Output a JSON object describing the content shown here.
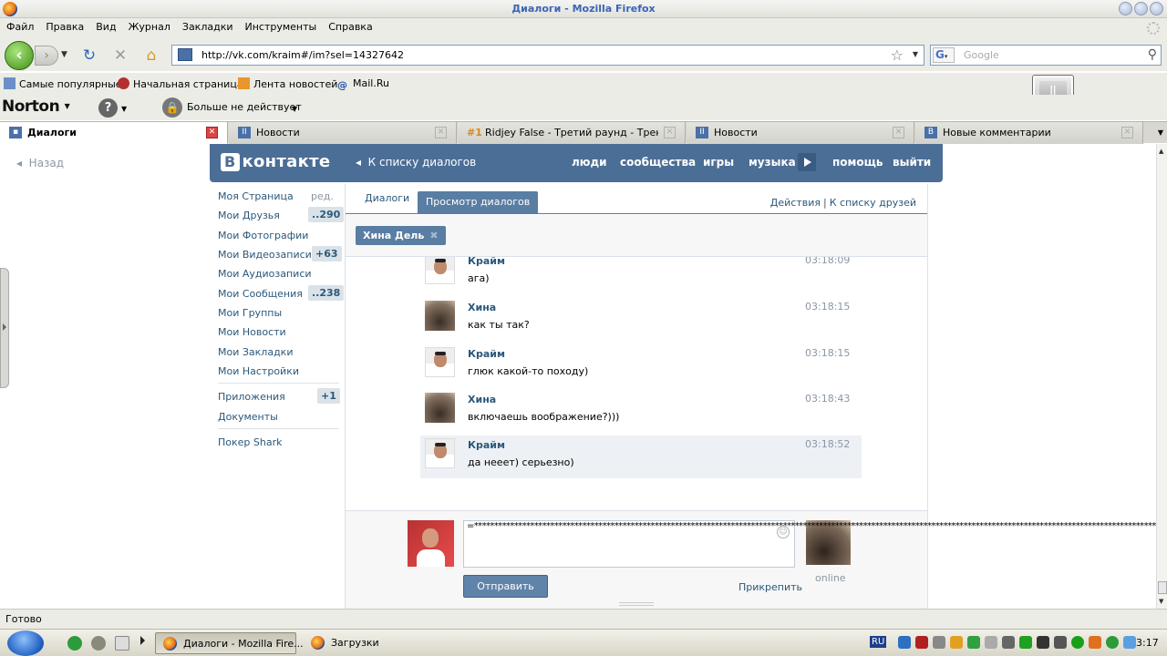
{
  "window": {
    "title": "Диалоги - Mozilla Firefox"
  },
  "menu": [
    "Файл",
    "Правка",
    "Вид",
    "Журнал",
    "Закладки",
    "Инструменты",
    "Справка"
  ],
  "nav": {
    "url": "http://vk.com/kraim#/im?sel=14327642",
    "search_placeholder": "Google"
  },
  "bookmarks": [
    "Самые популярные",
    "Начальная страница",
    "Лента новостей",
    "Mail.Ru"
  ],
  "norton": {
    "brand": "Norton",
    "status": "Больше не действует"
  },
  "tabs": [
    {
      "label": "Диалоги",
      "active": true
    },
    {
      "label": "Новости"
    },
    {
      "label": "Ridjey False - Третий раунд - Треки - ..."
    },
    {
      "label": "Новости"
    },
    {
      "label": "Новые комментарии"
    }
  ],
  "page": {
    "back": "Назад",
    "logo": "контакте",
    "logo_b": "В",
    "to_list": "К списку диалогов",
    "nav": [
      "люди",
      "сообщества",
      "игры",
      "музыка",
      "помощь",
      "выйти"
    ],
    "left_menu": [
      {
        "label": "Моя Страница",
        "extra": "ред."
      },
      {
        "label": "Мои Друзья",
        "badge": "..290"
      },
      {
        "label": "Мои Фотографии"
      },
      {
        "label": "Мои Видеозаписи",
        "badge": "+63"
      },
      {
        "label": "Мои Аудиозаписи"
      },
      {
        "label": "Мои Сообщения",
        "badge": "..238"
      },
      {
        "label": "Мои Группы"
      },
      {
        "label": "Мои Новости"
      },
      {
        "label": "Мои Закладки"
      },
      {
        "label": "Мои Настройки"
      },
      {
        "label": "Приложения",
        "badge": "+1"
      },
      {
        "label": "Документы"
      },
      {
        "label": "Покер Shark"
      }
    ],
    "tabs": {
      "dialogs": "Диалоги",
      "view": "Просмотр диалогов"
    },
    "actions": {
      "a1": "Действия",
      "sep": "|",
      "a2": "К списку друзей"
    },
    "chip": {
      "label": "Хина Дель",
      "close": "✖"
    },
    "messages": [
      {
        "name": "Крайм",
        "text": "ага)",
        "time": "03:18:09",
        "who": "kraim"
      },
      {
        "name": "Хина",
        "text": "как ты так?",
        "time": "03:18:15",
        "who": "hina"
      },
      {
        "name": "Крайм",
        "text": "глюк какой-то походу)",
        "time": "03:18:15",
        "who": "kraim"
      },
      {
        "name": "Хина",
        "text": "включаешь воображение?)))",
        "time": "03:18:43",
        "who": "hina"
      },
      {
        "name": "Крайм",
        "text": "да нееет) серьезно)",
        "time": "03:18:52",
        "who": "kraim",
        "highlight": true
      }
    ],
    "compose": {
      "draft": "=****************************************************************************************************************************************************************************************************************************",
      "send": "Отправить",
      "attach": "Прикрепить",
      "online": "online"
    }
  },
  "status": "Готово",
  "taskbar": {
    "items": [
      "Диалоги - Mozilla Fire...",
      "Загрузки"
    ],
    "lang": "RU",
    "clock": "3:17"
  }
}
